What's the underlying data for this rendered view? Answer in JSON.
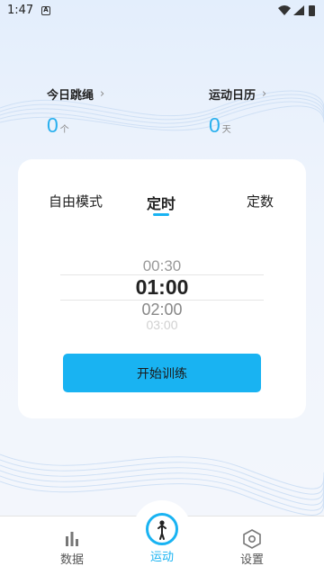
{
  "status_bar": {
    "time": "1:47",
    "notification_icon": "a-square-icon",
    "icons": [
      "wifi-icon",
      "signal-icon",
      "battery-icon"
    ]
  },
  "stats": {
    "today": {
      "title": "今日跳绳",
      "value": "0",
      "unit": "个"
    },
    "calendar": {
      "title": "运动日历",
      "value": "0",
      "unit": "天"
    }
  },
  "modes": {
    "tabs": [
      {
        "label": "自由模式",
        "active": false
      },
      {
        "label": "定时",
        "active": true
      },
      {
        "label": "定数",
        "active": false
      }
    ]
  },
  "picker": {
    "items": [
      "00:30",
      "01:00",
      "02:00",
      "03:00"
    ],
    "selected": "01:00"
  },
  "start_button": {
    "label": "开始训练"
  },
  "nav": {
    "items": [
      {
        "label": "数据",
        "icon": "bar-chart-icon",
        "active": false
      },
      {
        "label": "运动",
        "icon": "jump-rope-icon",
        "active": true
      },
      {
        "label": "设置",
        "icon": "hexagon-settings-icon",
        "active": false
      }
    ]
  },
  "colors": {
    "accent": "#19b3f2",
    "stat_value": "#2ab0ee"
  }
}
